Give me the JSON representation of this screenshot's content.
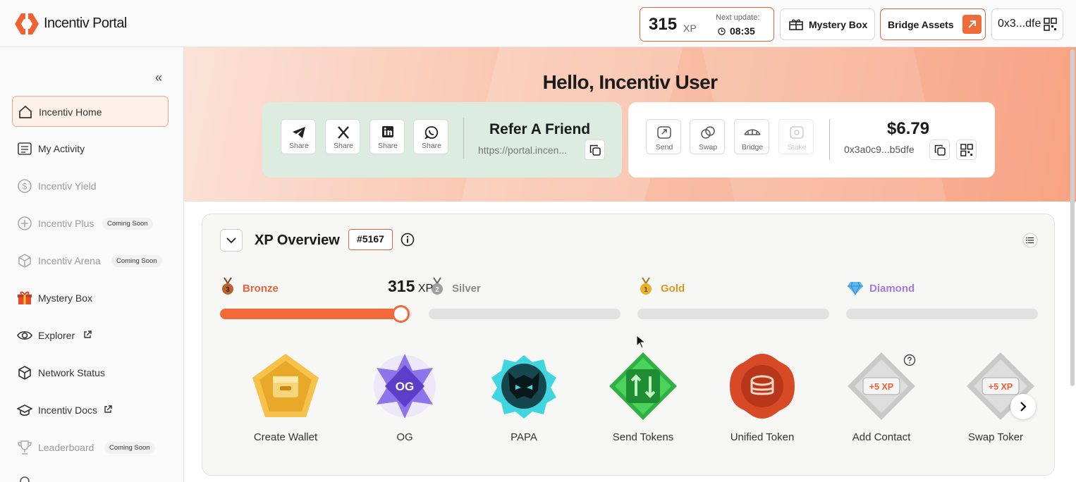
{
  "header": {
    "brand": "Incentiv Portal",
    "xp_value": "315",
    "xp_unit": "XP",
    "next_update_label": "Next update:",
    "next_update_time": "08:35",
    "mystery_box_label": "Mystery Box",
    "bridge_assets_label": "Bridge Assets",
    "wallet_short": "0x3...dfe"
  },
  "sidebar": {
    "items": [
      {
        "label": "Incentiv Home",
        "icon": "home-icon",
        "active": true
      },
      {
        "label": "My Activity",
        "icon": "activity-icon"
      },
      {
        "label": "Incentiv Yield",
        "icon": "dollar-icon",
        "dim": true
      },
      {
        "label": "Incentiv Plus",
        "icon": "plus-circle-icon",
        "dim": true,
        "badge": "Coming Soon"
      },
      {
        "label": "Incentiv Arena",
        "icon": "cube-icon",
        "dim": true,
        "badge": "Coming Soon"
      },
      {
        "label": "Mystery Box",
        "icon": "gift-icon"
      },
      {
        "label": "Explorer",
        "icon": "eye-icon",
        "external": true
      },
      {
        "label": "Network Status",
        "icon": "box-icon"
      },
      {
        "label": "Incentiv Docs",
        "icon": "graduation-cap-icon",
        "external": true
      },
      {
        "label": "Leaderboard",
        "icon": "trophy-icon",
        "dim": true,
        "badge": "Coming Soon"
      }
    ]
  },
  "hero": {
    "greeting": "Hello, Incentiv User",
    "refer": {
      "title": "Refer A Friend",
      "url": "https://portal.incen...",
      "share_buttons": [
        {
          "label": "Share",
          "icon": "telegram-icon"
        },
        {
          "label": "Share",
          "icon": "x-icon"
        },
        {
          "label": "Share",
          "icon": "linkedin-icon"
        },
        {
          "label": "Share",
          "icon": "whatsapp-icon"
        }
      ]
    },
    "wallet": {
      "balance": "$6.79",
      "address": "0x3a0c9...b5dfe",
      "actions": [
        {
          "label": "Send",
          "icon": "send-icon"
        },
        {
          "label": "Swap",
          "icon": "swap-icon"
        },
        {
          "label": "Bridge",
          "icon": "bridge-icon"
        },
        {
          "label": "Stake",
          "icon": "stake-icon",
          "disabled": true
        }
      ]
    }
  },
  "xp_overview": {
    "title": "XP Overview",
    "rank": "#5167",
    "current_xp": "315",
    "current_xp_unit": "XP",
    "progress_fraction": 0.94,
    "tiers": [
      {
        "name": "Bronze",
        "color": "#e8633a",
        "medal": "3"
      },
      {
        "name": "Silver",
        "color": "#8a8a8a",
        "medal": "2"
      },
      {
        "name": "Gold",
        "color": "#d79a1d",
        "medal": "1"
      },
      {
        "name": "Diamond",
        "color": "#a07ce0",
        "medal": "diamond"
      }
    ],
    "badges": [
      {
        "label": "Create Wallet",
        "icon": "wallet-badge-icon"
      },
      {
        "label": "OG",
        "icon": "og-badge-icon",
        "text": "OG"
      },
      {
        "label": "PAPA",
        "icon": "papa-badge-icon"
      },
      {
        "label": "Send Tokens",
        "icon": "send-tokens-badge-icon"
      },
      {
        "label": "Unified Token",
        "icon": "unified-token-badge-icon"
      },
      {
        "label": "Add Contact",
        "icon": "add-contact-badge-icon",
        "text": "+5 XP"
      },
      {
        "label": "Swap Toker",
        "icon": "swap-token-badge-icon",
        "text": "+5 XP"
      }
    ]
  },
  "colors": {
    "accent": "#f26a39",
    "refer_bg": "#dcece1",
    "hero_bg": "#f9c4ad"
  }
}
